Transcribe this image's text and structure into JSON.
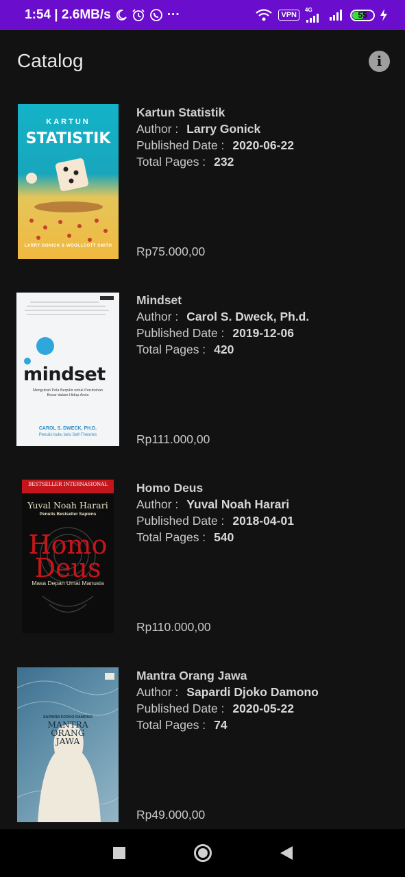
{
  "status_bar": {
    "time_speed": "1:54 | 2.6MB/s",
    "more": "···",
    "vpn": "VPN",
    "network": "4G",
    "battery": "55",
    "icons": [
      "moon-icon",
      "alarm-icon",
      "whatsapp-icon",
      "wifi-icon",
      "signal-icon",
      "charging-icon"
    ]
  },
  "app_bar": {
    "title": "Catalog",
    "info_icon": "i"
  },
  "labels": {
    "author": "Author :",
    "published": "Published Date :",
    "pages": "Total Pages :"
  },
  "books": [
    {
      "title": "Kartun Statistik",
      "author": "Larry Gonick",
      "published": "2020-06-22",
      "pages": "232",
      "price": "Rp75.000,00",
      "cover_lines": [
        "KARTUN",
        "STATISTIK",
        "LARRY GONICK & WOOLLCOTT SMITH"
      ]
    },
    {
      "title": "Mindset",
      "author": "Carol S. Dweck, Ph.d.",
      "published": "2019-12-06",
      "pages": "420",
      "price": "Rp111.000,00",
      "cover_lines": [
        "mindset",
        "Mengubah Pola Berpikir untuk Perubahan Besar dalam Hidup Anda",
        "CAROL S. DWECK, PH.D.",
        "Penulis buku laris Self-Theories"
      ]
    },
    {
      "title": "Homo Deus",
      "author": "Yuval Noah Harari",
      "published": "2018-04-01",
      "pages": "540",
      "price": "Rp110.000,00",
      "cover_lines": [
        "BESTSELLER INTERNASIONAL",
        "Yuval Noah Harari",
        "Penulis Bestseller Sapiens",
        "Homo",
        "Deus",
        "Masa Depan Umat Manusia"
      ]
    },
    {
      "title": "Mantra Orang Jawa",
      "author": "Sapardi Djoko Damono",
      "published": "2020-05-22",
      "pages": "74",
      "price": "Rp49.000,00",
      "cover_lines": [
        "SAPARDI DJOKO DAMONO",
        "MANTRA ORANG JAWA"
      ]
    }
  ]
}
